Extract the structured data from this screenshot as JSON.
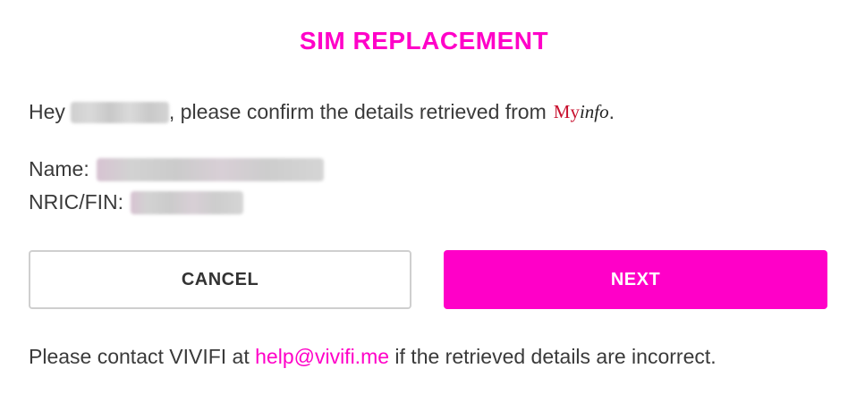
{
  "colors": {
    "accent": "#ff00c8",
    "text": "#3a3a3a",
    "cancel_border": "#cfcfcf",
    "myinfo_red": "#c8102e"
  },
  "header": {
    "title": "SIM REPLACEMENT"
  },
  "greeting": {
    "prefix": "Hey",
    "suffix": ", please confirm the details retrieved from",
    "source_logo_my": "My",
    "source_logo_info": "info",
    "end": "."
  },
  "details": {
    "name_label": "Name:",
    "nric_label": "NRIC/FIN:"
  },
  "actions": {
    "cancel_label": "CANCEL",
    "next_label": "NEXT"
  },
  "footer": {
    "prefix": "Please contact VIVIFI at",
    "email": "help@vivifi.me",
    "suffix": "if the retrieved details are incorrect."
  }
}
